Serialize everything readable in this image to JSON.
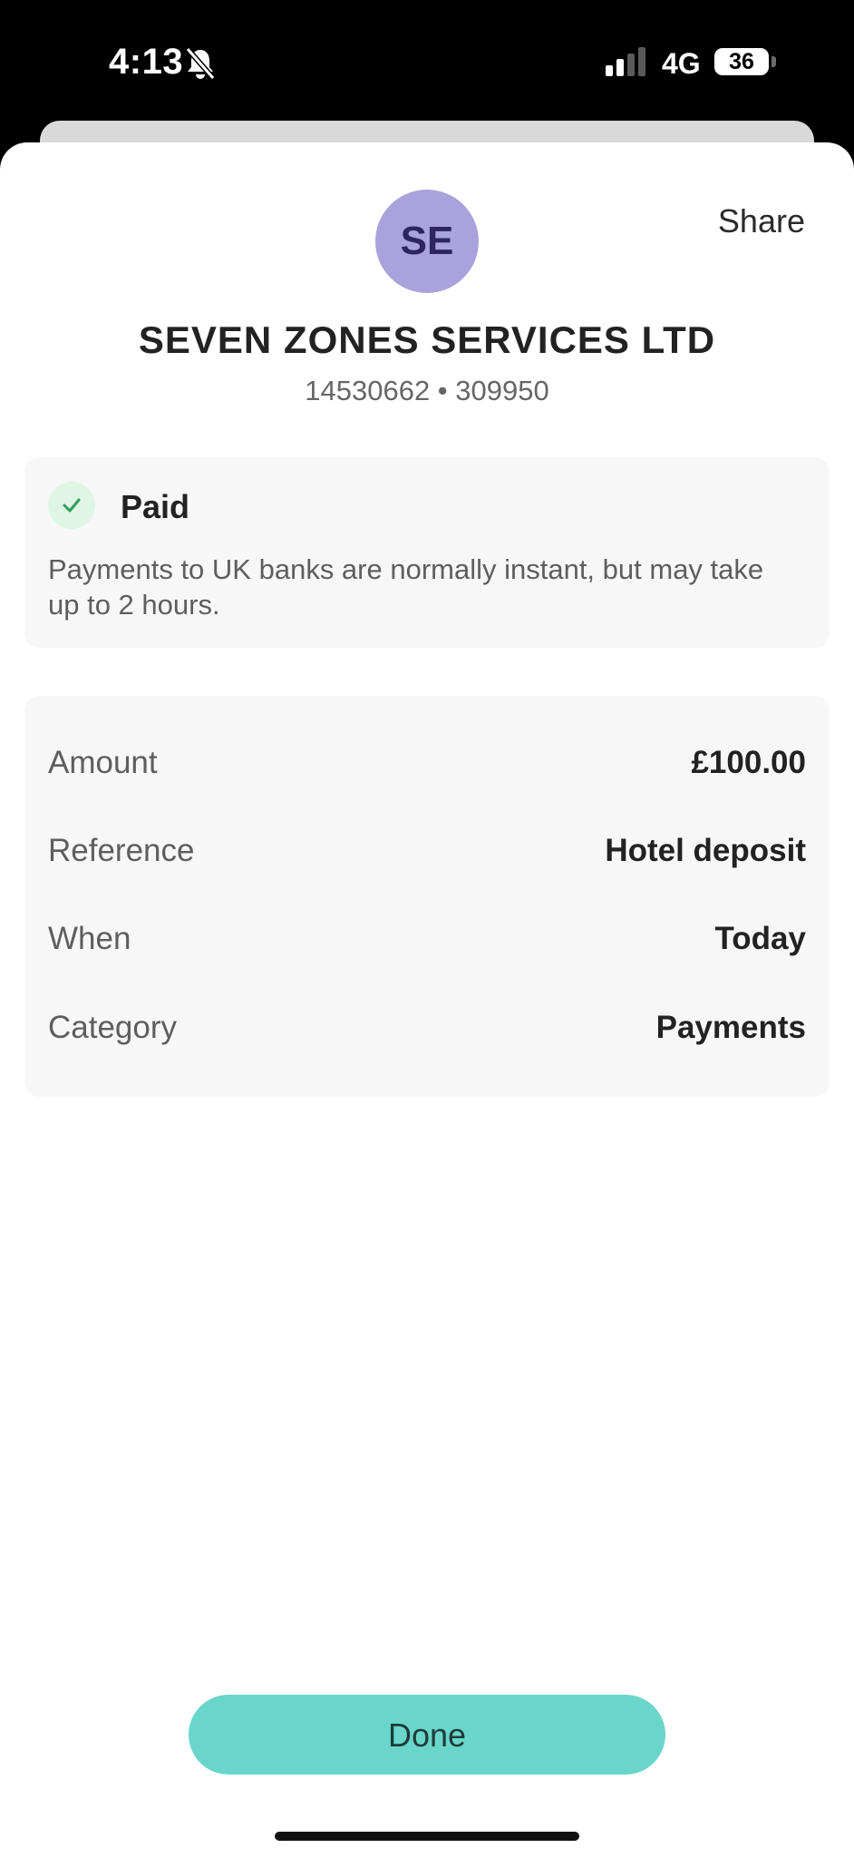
{
  "status_bar": {
    "time": "4:13",
    "network": "4G",
    "battery": "36",
    "icons": [
      "bell-muted-icon",
      "signal-icon"
    ]
  },
  "header": {
    "share_label": "Share",
    "avatar_initials": "SE",
    "payee_name": "SEVEN ZONES SERVICES LTD",
    "payee_account": "14530662 • 309950"
  },
  "status": {
    "title": "Paid",
    "description": "Payments to UK banks are normally instant, but may take up to 2 hours.",
    "icon": "check-icon"
  },
  "details": [
    {
      "label": "Amount",
      "value": "£100.00"
    },
    {
      "label": "Reference",
      "value": "Hotel deposit"
    },
    {
      "label": "When",
      "value": "Today"
    },
    {
      "label": "Category",
      "value": "Payments"
    }
  ],
  "footer": {
    "done_label": "Done"
  },
  "colors": {
    "accent": "#6ad6cb",
    "avatar_bg": "#a9a2dc",
    "success": "#2e9e5b"
  }
}
